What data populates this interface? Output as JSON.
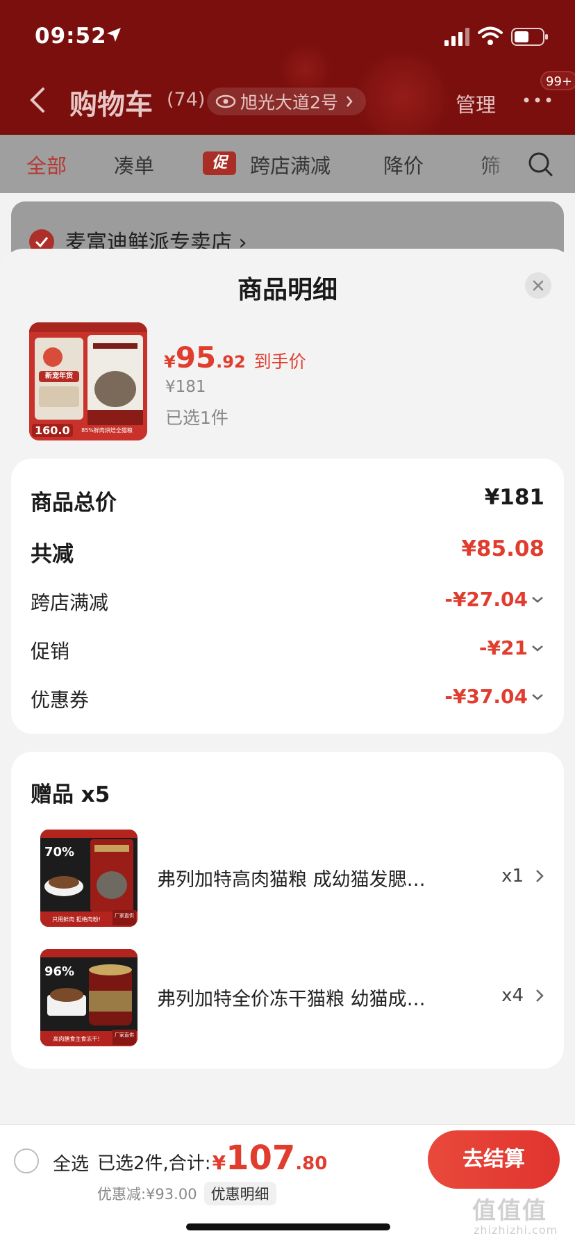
{
  "status_bar": {
    "time": "09:52"
  },
  "nav": {
    "title": "购物车",
    "count": "(74)",
    "address": "旭光大道2号",
    "manage": "管理",
    "badge": "99+"
  },
  "tabs": [
    {
      "label": "全部"
    },
    {
      "label": "凑单"
    },
    {
      "tag": "促",
      "label": "跨店满减"
    },
    {
      "label": "降价"
    },
    {
      "label": "筛"
    }
  ],
  "shop": {
    "name": "麦富迪鲜派专卖店 ›"
  },
  "sheet": {
    "title": "商品明细",
    "product": {
      "currency": "¥",
      "price_int": "95",
      "price_dec": ".92",
      "price_label": "到手价",
      "original_price": "¥181",
      "selected": "已选1件",
      "image_texts": {
        "tag": "新宠年货",
        "price": "160.0",
        "caption": "85%鲜肉烘焙全猫粮"
      }
    },
    "summary": {
      "total_label": "商品总价",
      "total_value": "¥181",
      "reduce_label": "共减",
      "reduce_value": "¥85.08",
      "items": [
        {
          "label": "跨店满减",
          "value": "-¥27.04"
        },
        {
          "label": "促销",
          "value": "-¥21"
        },
        {
          "label": "优惠券",
          "value": "-¥37.04"
        }
      ]
    },
    "gifts": {
      "title": "赠品 x5",
      "items": [
        {
          "name": "弗列加特高肉猫粮 成幼猫发腮…",
          "qty": "x1",
          "img_big": "70%",
          "img_caption": "只用鲜肉 拒绝肉粉!",
          "img_badge": "厂家直供"
        },
        {
          "name": "弗列加特全价冻干猫粮 幼猫成…",
          "qty": "x4",
          "img_big": "96%",
          "img_caption": "高肉膳食主食冻干!",
          "img_badge": "厂家直供"
        }
      ]
    }
  },
  "bottom_bar": {
    "select_all": "全选",
    "summary_label": "已选2件,合计:",
    "currency": "¥",
    "total_int": "107",
    "total_dec": ".80",
    "discount": "优惠减:¥93.00",
    "detail_link": "优惠明细",
    "checkout": "去结算",
    "watermark": "值值值",
    "watermark_url": "zhizhizhi.com"
  },
  "colors": {
    "brand_red": "#e03d2f",
    "header_red": "#7a0f0d"
  }
}
